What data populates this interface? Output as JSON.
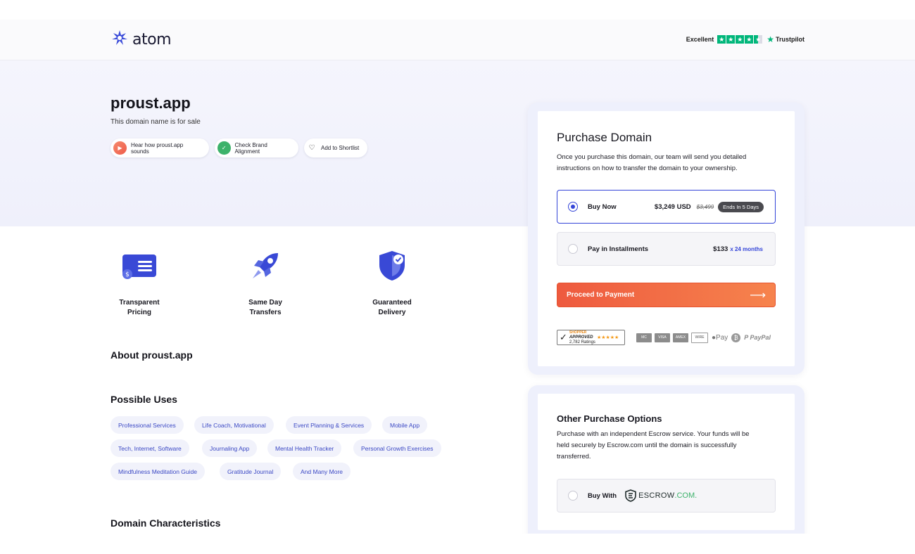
{
  "header": {
    "logo_text": "atom",
    "trust_label": "Excellent",
    "trust_brand": "Trustpilot"
  },
  "hero": {
    "domain": "proust.app",
    "subtitle": "This domain name is for sale",
    "pills": [
      {
        "label": "Hear how proust.app sounds",
        "icon": "play-icon"
      },
      {
        "label": "Check Brand Alignment",
        "icon": "check-icon"
      },
      {
        "label": "Add to Shortlist",
        "icon": "heart-icon"
      }
    ]
  },
  "features": [
    {
      "label_1": "Transparent",
      "label_2": "Pricing",
      "icon": "pricing-card-icon"
    },
    {
      "label_1": "Same Day",
      "label_2": "Transfers",
      "icon": "rocket-icon"
    },
    {
      "label_1": "Guaranteed",
      "label_2": "Delivery",
      "icon": "shield-check-icon"
    }
  ],
  "about_heading": "About proust.app",
  "uses": {
    "heading": "Possible Uses",
    "tags": [
      "Professional Services",
      "Life Coach, Motivational",
      "Event Planning & Services",
      "Mobile App",
      "Tech, Internet, Software",
      "Journaling App",
      "Mental Health Tracker",
      "Personal Growth Exercises",
      "Mindfulness Meditation Guide",
      "Gratitude Journal",
      "And Many More"
    ]
  },
  "characteristics_heading": "Domain Characteristics",
  "purchase": {
    "title": "Purchase Domain",
    "desc_line_1": "Once you purchase this domain, our team will send you detailed",
    "desc_line_2": "instructions on how to transfer the domain to your ownership.",
    "buy_now": {
      "label": "Buy Now",
      "price": "$3,249 USD",
      "old_price": "$3,499",
      "badge": "Ends In 5 Days",
      "selected": true
    },
    "installments": {
      "label": "Pay in Installments",
      "price": "$133",
      "term": "x 24 months",
      "selected": false
    },
    "proceed_label": "Proceed to Payment",
    "shopper_approved": "APPROVED",
    "shopper_top": "SHOPPER",
    "shopper_ratings": "2,782 Ratings",
    "payment_methods": [
      "MC",
      "VISA",
      "AMEX",
      "WIRE"
    ],
    "apple_pay": "Pay",
    "paypal": "PayPal"
  },
  "other": {
    "title": "Other Purchase Options",
    "desc_line_1": "Purchase with an independent Escrow service. Your funds will be",
    "desc_line_2": "held securely by Escrow.com until the domain is successfully",
    "desc_line_3": "transferred.",
    "buy_with": "Buy With",
    "escrow_main": "ESCROW",
    "escrow_tld": ".COM."
  },
  "colors": {
    "accent_blue": "#3445d8",
    "orange": "#f06a45",
    "trustpilot_green": "#00b67a"
  }
}
